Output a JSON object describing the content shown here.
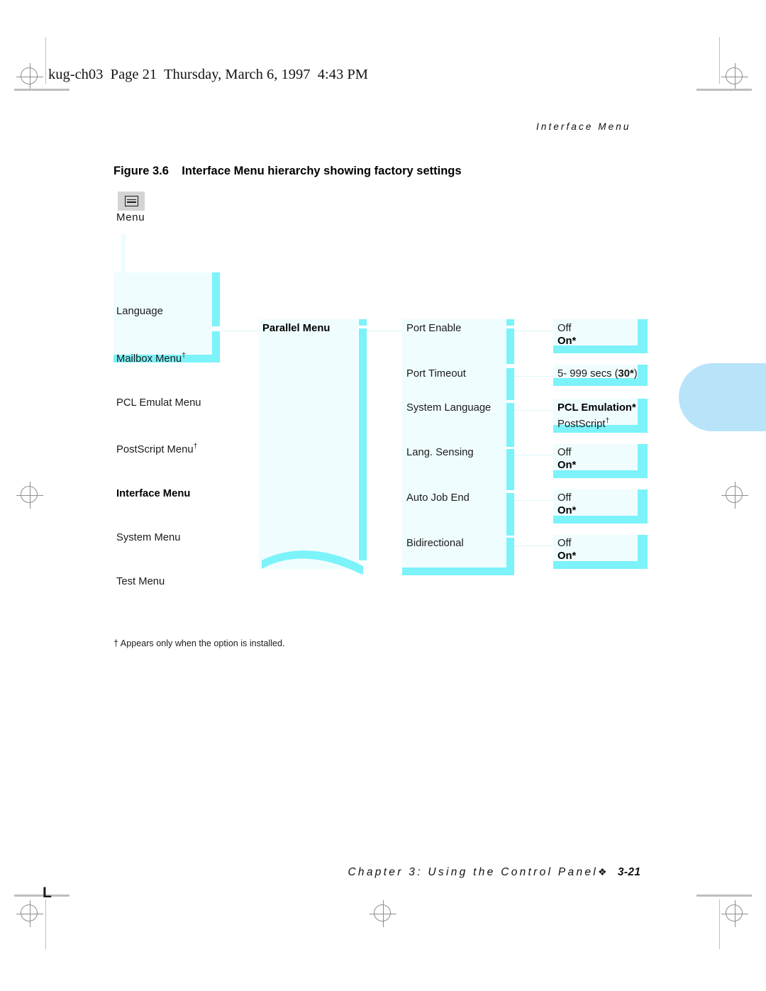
{
  "page": {
    "slug": "kug-ch03  Page 21  Thursday, March 6, 1997  4:43 PM",
    "running_head": "Interface Menu",
    "figure_caption": "Figure 3.6    Interface Menu hierarchy showing factory settings",
    "footnote": "† Appears only when the option is installed.",
    "footer_text": "Chapter 3: Using the Control Panel",
    "footer_ornament": "❖",
    "footer_page_number": "3-21",
    "corner_mark": "L"
  },
  "colors": {
    "cyan_bar": "#7cf2f9",
    "cyan_fill": "#f0fdff",
    "thumb_tab": "#b8e4fa",
    "text": "#1b1b1b",
    "regmark": "#8d8d8d"
  },
  "figure": {
    "root": {
      "icon_name": "menu-panel-icon",
      "label": "Menu"
    },
    "level1_menus": [
      {
        "label": "Language",
        "bold": false,
        "dagger": false
      },
      {
        "label": "Mailbox Menu",
        "bold": false,
        "dagger": true
      },
      {
        "label": "PCL Emulat Menu",
        "bold": false,
        "dagger": false
      },
      {
        "label": "PostScript Menu",
        "bold": false,
        "dagger": true
      },
      {
        "label": "Interface Menu",
        "bold": true,
        "dagger": false
      },
      {
        "label": "System Menu",
        "bold": false,
        "dagger": false
      },
      {
        "label": "Test Menu",
        "bold": false,
        "dagger": false
      }
    ],
    "level2": {
      "label": "Parallel Menu",
      "bold": true
    },
    "level3_items": [
      {
        "label": "Port Enable",
        "values": [
          {
            "text": "Off",
            "bold": false
          },
          {
            "text": "On*",
            "bold": true
          }
        ]
      },
      {
        "label": "Port Timeout",
        "values": [
          {
            "text": "5- 999 secs (",
            "bold": false,
            "inline_bold": "30*",
            "suffix": ")"
          }
        ]
      },
      {
        "label": "System Language",
        "values": [
          {
            "text": "PCL Emulation*",
            "bold": true
          },
          {
            "text": "PostScript",
            "bold": false,
            "dagger": true
          }
        ]
      },
      {
        "label": "Lang. Sensing",
        "values": [
          {
            "text": "Off",
            "bold": false
          },
          {
            "text": "On*",
            "bold": true
          }
        ]
      },
      {
        "label": "Auto Job End",
        "values": [
          {
            "text": "Off",
            "bold": false
          },
          {
            "text": "On*",
            "bold": true
          }
        ]
      },
      {
        "label": "Bidirectional",
        "values": [
          {
            "text": "Off",
            "bold": false
          },
          {
            "text": "On*",
            "bold": true
          }
        ]
      }
    ]
  }
}
